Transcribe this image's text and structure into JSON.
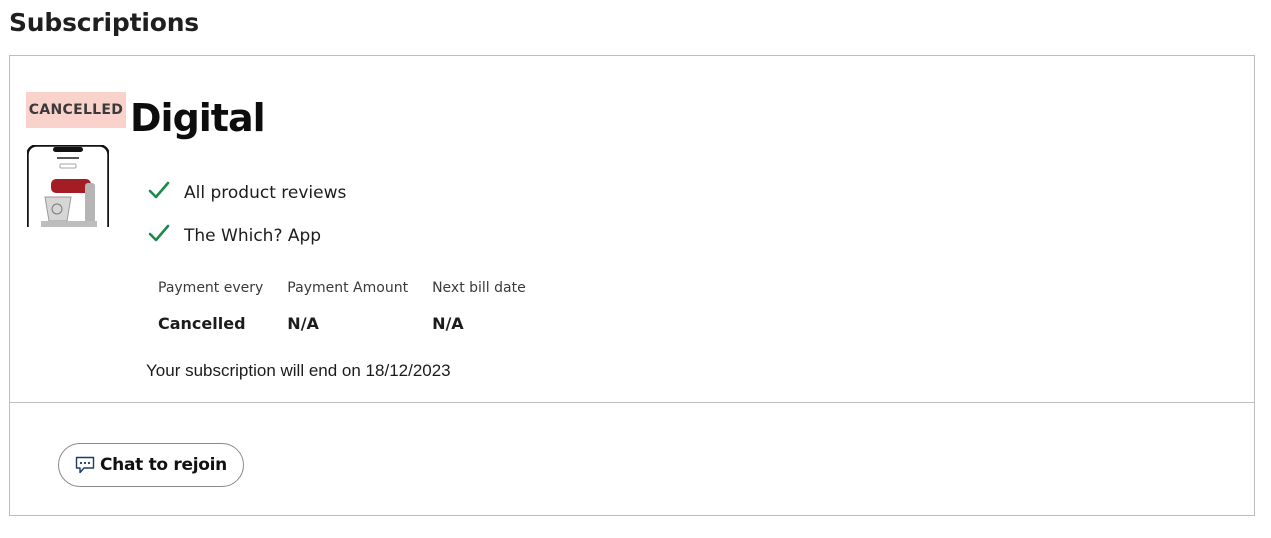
{
  "page": {
    "title": "Subscriptions"
  },
  "subscription": {
    "status": "CANCELLED",
    "status_color": "#f9d2cb",
    "plan_name": "Digital",
    "product_image": "phone-with-stand-mixer",
    "features": [
      {
        "icon": "check-icon",
        "label": "All product reviews"
      },
      {
        "icon": "check-icon",
        "label": "The Which? App"
      }
    ],
    "check_color": "#1c8a4a",
    "payment_table": {
      "headers": [
        "Payment every",
        "Payment Amount",
        "Next bill date"
      ],
      "values": [
        "Cancelled",
        "N/A",
        "N/A"
      ]
    },
    "end_note": "Your subscription will end on 18/12/2023"
  },
  "actions": {
    "chat_label": "Chat to rejoin",
    "chat_icon": "chat-bubble-icon"
  }
}
